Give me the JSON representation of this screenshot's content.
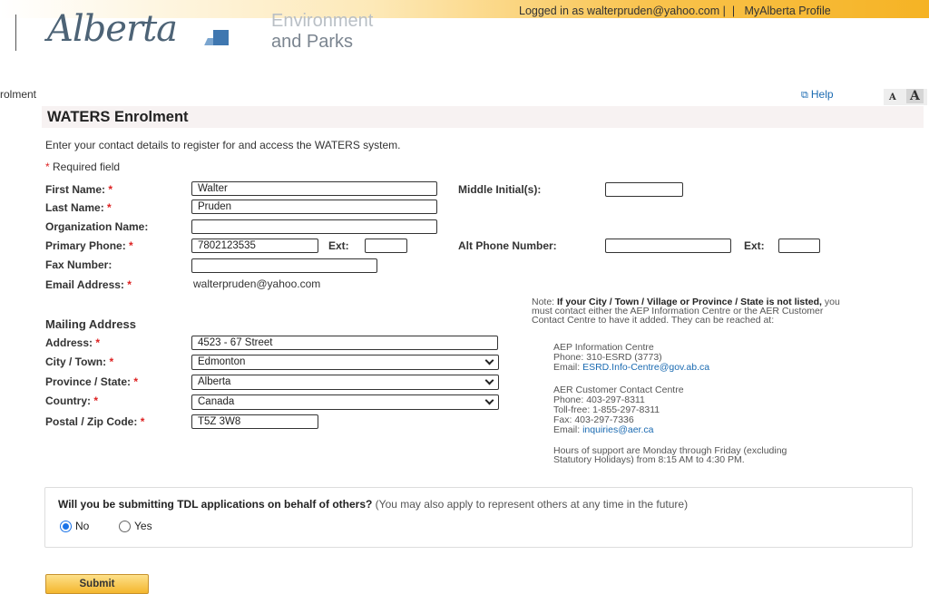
{
  "header": {
    "logo_text": "Alberta",
    "dept_line1": "Environment",
    "dept_line2": "and Parks",
    "login_text": "Logged in as walterpruden@yahoo.com |",
    "separator": "|",
    "profile_link": "MyAlberta Profile"
  },
  "breadcrumb": "rolment",
  "help_label": "Help",
  "font_small": "A",
  "font_large": "A",
  "page_title": "WATERS Enrolment",
  "intro": "Enter your contact details to register for and access the WATERS system.",
  "required_note": "Required field",
  "form": {
    "first_name_label": "First Name:",
    "first_name": "Walter",
    "middle_initial_label": "Middle Initial(s):",
    "middle_initial": "",
    "last_name_label": "Last Name:",
    "last_name": "Pruden",
    "org_label": "Organization Name:",
    "org": "",
    "primary_phone_label": "Primary Phone:",
    "primary_phone": "7802123535",
    "ext_label": "Ext:",
    "ext": "",
    "alt_phone_label": "Alt Phone Number:",
    "alt_phone": "",
    "alt_ext_label": "Ext:",
    "alt_ext": "",
    "fax_label": "Fax Number:",
    "fax": "",
    "email_label": "Email Address:",
    "email": "walterpruden@yahoo.com"
  },
  "mailing": {
    "heading": "Mailing Address",
    "address_label": "Address:",
    "address": "4523 - 67 Street",
    "city_label": "City / Town:",
    "city": "Edmonton",
    "province_label": "Province / State:",
    "province": "Alberta",
    "country_label": "Country:",
    "country": "Canada",
    "postal_label": "Postal / Zip Code:",
    "postal": "T5Z 3W8"
  },
  "note": {
    "prefix": "Note: ",
    "bold": "If your City / Town / Village or Province / State is not listed,",
    "rest": " you must contact either the AEP Information Centre or the AER Customer Contact Centre to have it added. They can be reached at:"
  },
  "aep": {
    "name": "AEP Information Centre",
    "phone": "Phone: 310-ESRD (3773)",
    "email_label": "Email: ",
    "email": "ESRD.Info-Centre@gov.ab.ca"
  },
  "aer": {
    "name": "AER Customer Contact Centre",
    "phone": "Phone: 403-297-8311",
    "tollfree": "Toll-free: 1-855-297-8311",
    "fax": "Fax: 403-297-7336",
    "email_label": "Email: ",
    "email": "inquiries@aer.ca"
  },
  "hours": "Hours of support are Monday through Friday (excluding Statutory Holidays) from 8:15 AM to 4:30 PM.",
  "question": {
    "bold": "Will you be submitting TDL applications on behalf of others?",
    "rest": " (You may also apply to represent others at any time in the future)",
    "option_no": "No",
    "option_yes": "Yes",
    "selected": "No"
  },
  "submit_label": "Submit",
  "colors": {
    "accent": "#f5b324",
    "link": "#1a6ab1",
    "required": "#d22222"
  }
}
